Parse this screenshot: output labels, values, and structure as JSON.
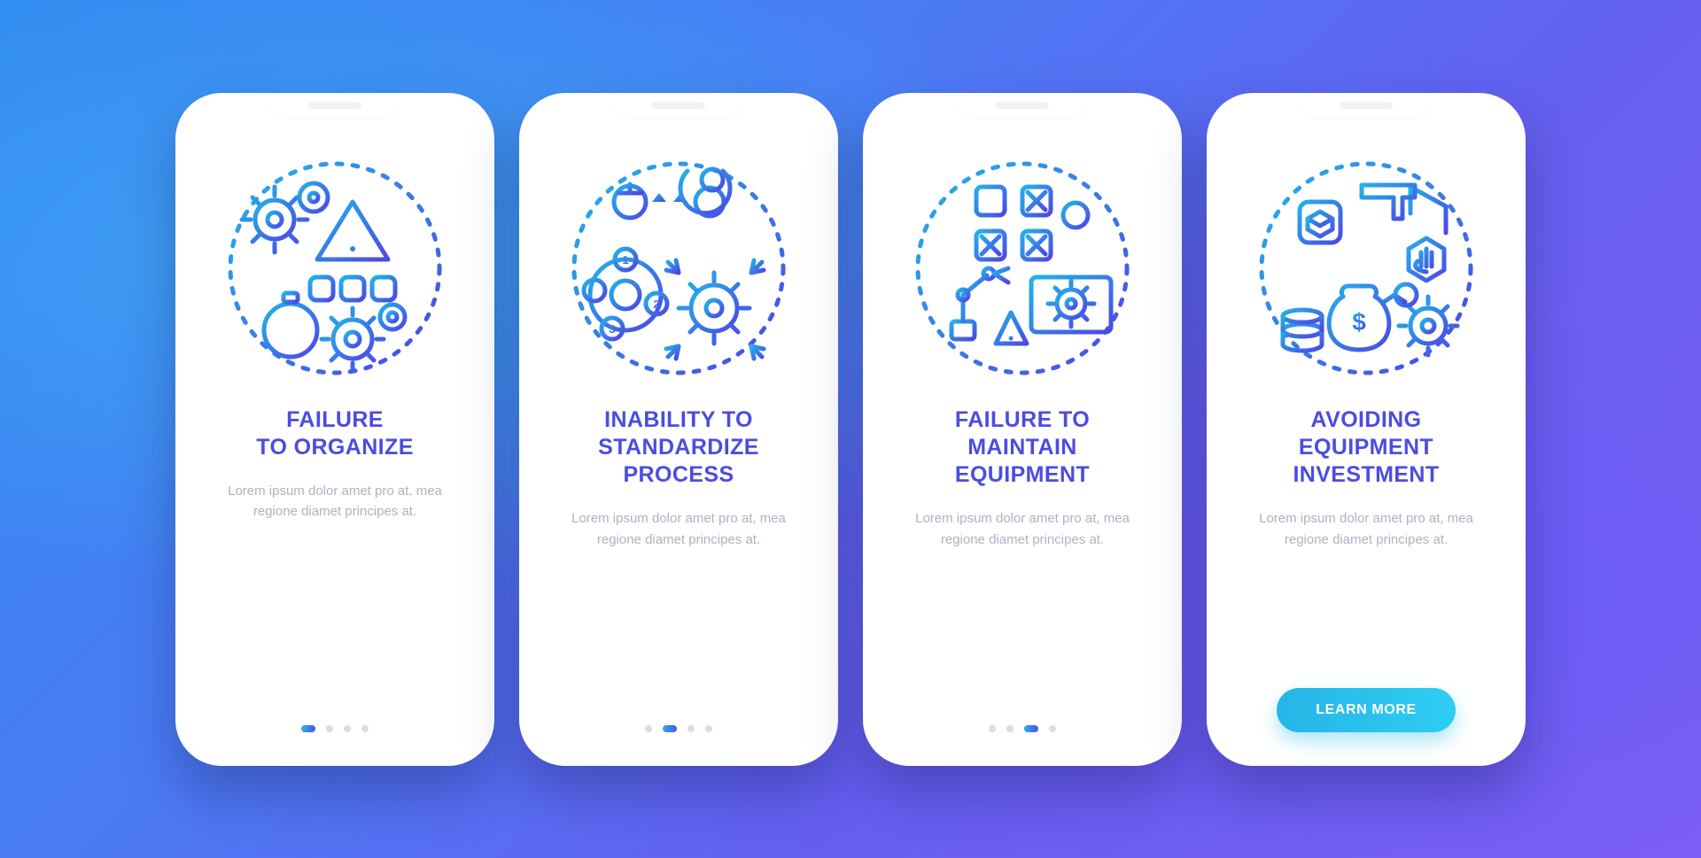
{
  "screens": [
    {
      "title": "FAILURE\nTO ORGANIZE",
      "description": "Lorem ipsum dolor amet pro at, mea regione diamet principes at.",
      "active_dot": 0,
      "cta": false
    },
    {
      "title": "INABILITY TO\nSTANDARDIZE\nPROCESS",
      "description": "Lorem ipsum dolor amet pro at, mea regione diamet principes at.",
      "active_dot": 1,
      "cta": false
    },
    {
      "title": "FAILURE TO\nMAINTAIN\nEQUIPMENT",
      "description": "Lorem ipsum dolor amet pro at, mea regione diamet principes at.",
      "active_dot": 2,
      "cta": false
    },
    {
      "title": "AVOIDING\nEQUIPMENT\nINVESTMENT",
      "description": "Lorem ipsum dolor amet pro at, mea regione diamet principes at.",
      "active_dot": 3,
      "cta": true,
      "cta_label": "LEARN MORE"
    }
  ],
  "dot_count": 4
}
